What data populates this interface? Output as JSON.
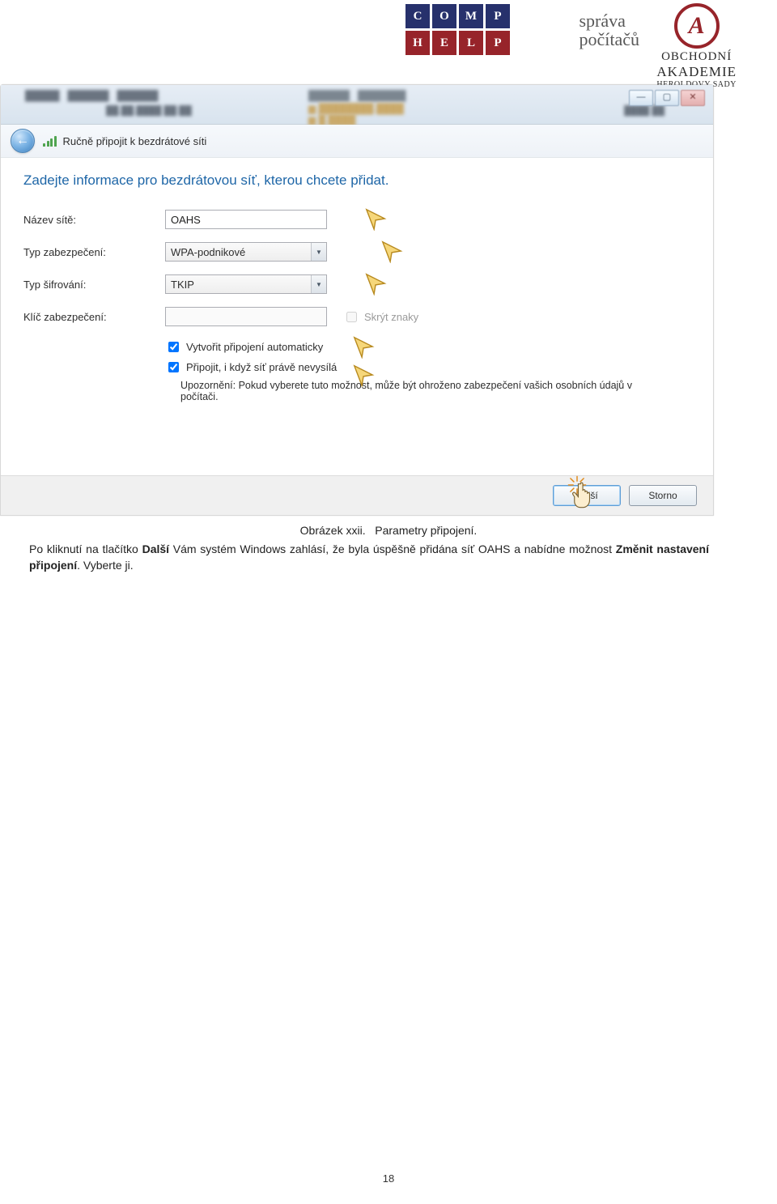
{
  "header": {
    "logo_grid": [
      "C",
      "O",
      "M",
      "P",
      "H",
      "E",
      "L",
      "P"
    ],
    "sprava_line1": "správa",
    "sprava_line2": "počítačů",
    "akademie_line1": "OBCHODNÍ",
    "akademie_line2": "AKADEMIE",
    "akademie_line3": "HEROLDOVY SADY"
  },
  "window": {
    "min_glyph": "—",
    "max_glyph": "▢",
    "close_glyph": "✕",
    "back_glyph": "←",
    "wizard_title": "Ručně připojit k bezdrátové síti"
  },
  "form": {
    "instruction": "Zadejte informace pro bezdrátovou síť, kterou chcete přidat.",
    "label_name": "Název sítě:",
    "value_name": "OAHS",
    "label_sectype": "Typ zabezpečení:",
    "value_sectype": "WPA-podnikové",
    "label_enc": "Typ šifrování:",
    "value_enc": "TKIP",
    "label_key": "Klíč zabezpečení:",
    "value_key": "",
    "hide_chars": "Skrýt znaky",
    "chk_auto": "Vytvořit připojení automaticky",
    "chk_connect": "Připojit, i když síť právě nevysílá",
    "warning": "Upozornění: Pokud vyberete tuto možnost, může být ohroženo zabezpečení vašich osobních údajů v počítači.",
    "btn_next": "Další",
    "btn_cancel": "Storno"
  },
  "caption": {
    "prefix": "Obrázek xxii.",
    "text": "Parametry připojení."
  },
  "paragraph": {
    "p1": "Po kliknutí na tlačítko ",
    "b1": "Další",
    "p2": " Vám systém Windows zahlásí, že byla úspěšně přidána síť OAHS a nabídne možnost ",
    "b2": "Změnit nastavení připojení",
    "p3": ". Vyberte ji."
  },
  "page_number": "18"
}
